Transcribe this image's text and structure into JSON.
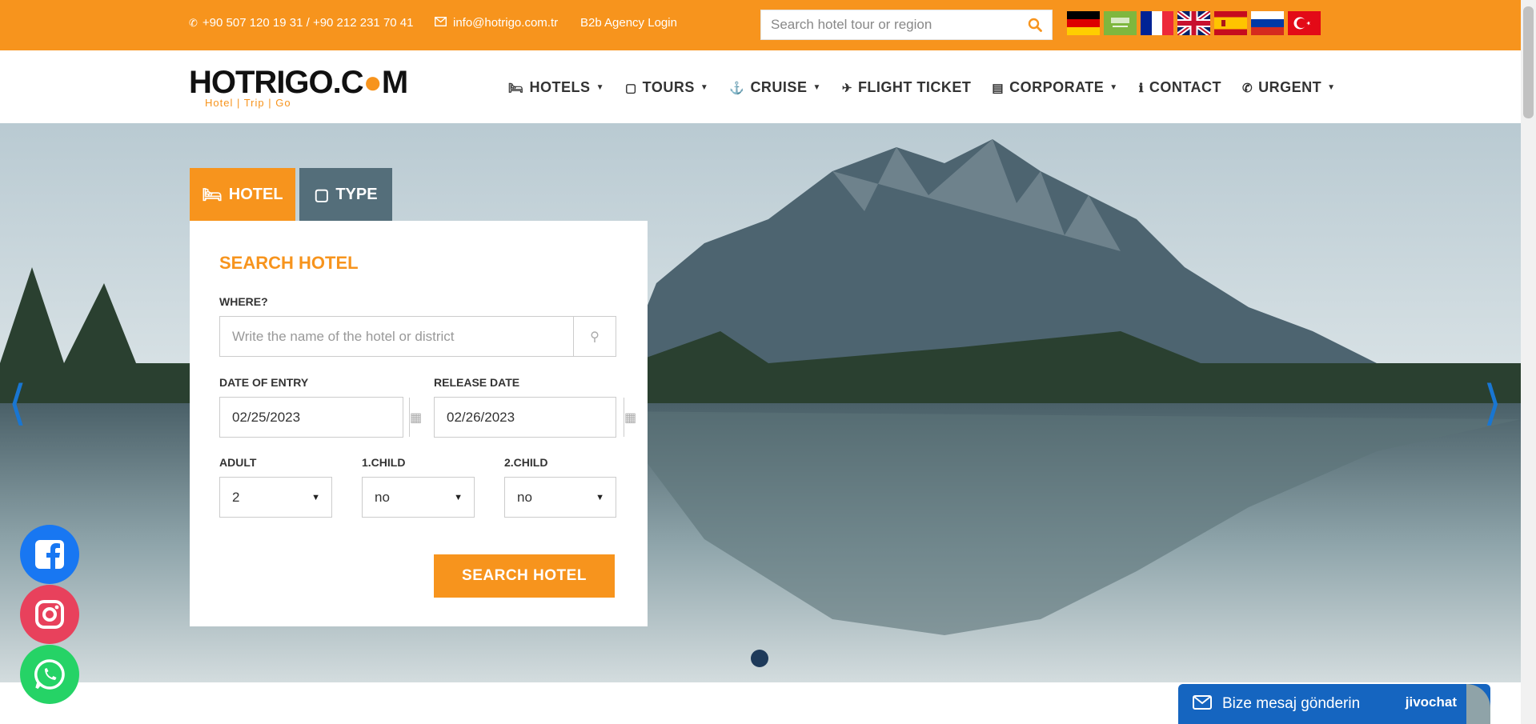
{
  "topbar": {
    "phone": "+90 507 120 19 31 / +90 212 231 70 41",
    "email": "info@hotrigo.com.tr",
    "b2b": "B2b Agency Login",
    "search_placeholder": "Search hotel tour or region",
    "flags": [
      "German",
      "Arabic",
      "French",
      "English",
      "Spanish",
      "Russian",
      "Turkish"
    ]
  },
  "header": {
    "logo_word": "HOTRIGO.C",
    "logo_word_end": "M",
    "logo_tagline": "Hotel | Trip | Go",
    "nav": [
      {
        "label": "HOTELS",
        "icon": "bed-icon",
        "dropdown": true
      },
      {
        "label": "TOURS",
        "icon": "briefcase-icon",
        "dropdown": true
      },
      {
        "label": "CRUISE",
        "icon": "ship-icon",
        "dropdown": true
      },
      {
        "label": "FLIGHT TICKET",
        "icon": "plane-icon",
        "dropdown": false
      },
      {
        "label": "CORPORATE",
        "icon": "file-icon",
        "dropdown": true
      },
      {
        "label": "CONTACT",
        "icon": "info-icon",
        "dropdown": false
      },
      {
        "label": "URGENT",
        "icon": "phone-icon",
        "dropdown": true
      }
    ]
  },
  "tabs": {
    "hotel": "HOTEL",
    "type": "TYPE"
  },
  "form": {
    "title": "SEARCH HOTEL",
    "where_label": "WHERE?",
    "where_placeholder": "Write the name of the hotel or district",
    "entry_label": "DATE OF ENTRY",
    "entry_value": "02/25/2023",
    "release_label": "RELEASE DATE",
    "release_value": "02/26/2023",
    "adult_label": "ADULT",
    "adult_value": "2",
    "child1_label": "1.CHILD",
    "child1_value": "no",
    "child2_label": "2.CHILD",
    "child2_value": "no",
    "submit": "SEARCH HOTEL"
  },
  "chat": {
    "message": "Bize mesaj gönderin",
    "brand": "jivochat"
  },
  "colors": {
    "accent": "#f7941d",
    "tab_type": "#546e7a",
    "chat": "#1565c0"
  }
}
